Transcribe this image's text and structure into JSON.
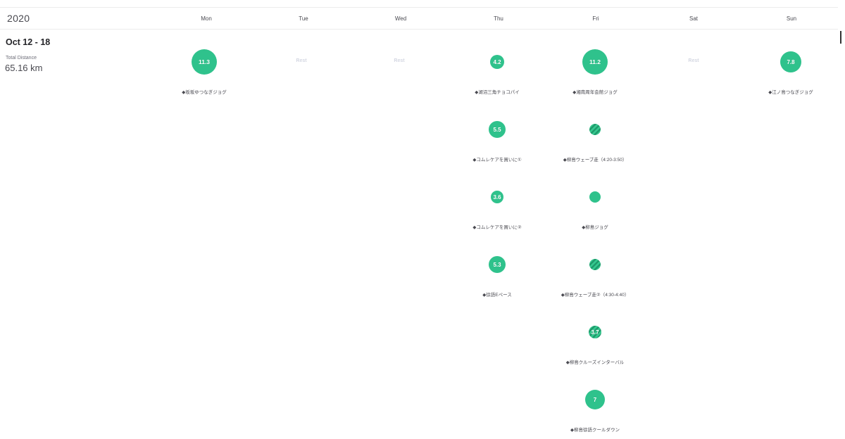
{
  "header": {
    "year": "2020",
    "days": [
      "Mon",
      "Tue",
      "Wed",
      "Thu",
      "Fri",
      "Sat",
      "Sun"
    ]
  },
  "week": {
    "range": "Oct 12 - 18",
    "total_label": "Total Distance",
    "total_value": "65.16 km"
  },
  "rest_label": "Rest",
  "colors": {
    "accent": "#2fc28c",
    "stripe_dark": "#1f9a6c",
    "rest_text": "#d4d7e2",
    "border": "#ececec"
  },
  "activities": {
    "mon": [
      {
        "value": "11.3",
        "label": "◆坂坂ゆつなぎジョグ"
      }
    ],
    "thu": [
      {
        "value": "4.2",
        "label": "◆湖沼三角チョコパイ"
      },
      {
        "value": "5.5",
        "label": "◆コムレケアを買いに①"
      },
      {
        "value": "3.6",
        "label": "◆コムレケアを買いに②"
      },
      {
        "value": "5.3",
        "label": "◆徐語Eペース"
      }
    ],
    "fri": [
      {
        "value": "11.2",
        "label": "◆湘南周年会館ジョグ"
      },
      {
        "value": "",
        "label": "◆柳島ウェーブ走（4:20-3:50）"
      },
      {
        "value": "",
        "label": "◆柳島ジョグ"
      },
      {
        "value": "",
        "label": "◆柳島ウェーブ走②（4:30-4:40）"
      },
      {
        "value": "3.7",
        "label": "◆柳島クルーズインターバル"
      },
      {
        "value": "7",
        "label": "◆柳島徐語クールダウン"
      }
    ],
    "sun": [
      {
        "value": "7.8",
        "label": "◆江ノ島つなぎジョグ"
      }
    ]
  }
}
